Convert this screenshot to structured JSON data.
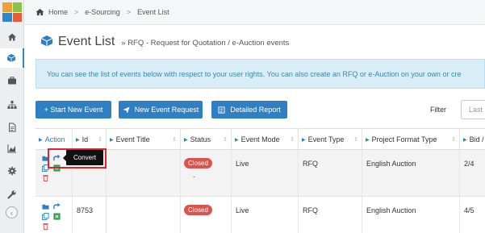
{
  "breadcrumb": {
    "home": "Home",
    "section": "e-Sourcing",
    "current": "Event List",
    "separator": ">"
  },
  "page": {
    "title": "Event List",
    "subtitle": "» RFQ - Request for Quotation / e-Auction events"
  },
  "info": "You can see the list of events below with respect to your user rights. You can also create an RFQ or e-Auction on your own or cre",
  "toolbar": {
    "start_new_event": "+ Start New Event",
    "new_event_request": "New Event Request",
    "detailed_report": "Detailed Report",
    "filter_label": "Filter",
    "filter_value": "Last"
  },
  "table": {
    "columns": [
      "Action",
      "Id",
      "Event Title",
      "Status",
      "Event Mode",
      "Event Type",
      "Project Format Type",
      "Bid / I"
    ],
    "rows": [
      {
        "id": "",
        "title": "",
        "status": "Closed",
        "status_sub": "-",
        "mode": "Live",
        "type": "RFQ",
        "format": "English Auction",
        "bid": "2/4"
      },
      {
        "id": "8753",
        "title": "",
        "status": "Closed",
        "status_sub": "",
        "mode": "Live",
        "type": "RFQ",
        "format": "English Auction",
        "bid": "4/5"
      }
    ]
  },
  "tooltip": "Convert",
  "sidebar": {
    "items": [
      "home-icon",
      "cube-icon",
      "briefcase-icon",
      "org-chart-icon",
      "document-icon",
      "chart-icon",
      "gear-icon",
      "wrench-icon"
    ],
    "collapse": "‹"
  },
  "colors": {
    "primary": "#2f80c2",
    "status_closed": "#d9534f",
    "info_bg": "#d9edf7",
    "highlight": "#d9262b"
  }
}
